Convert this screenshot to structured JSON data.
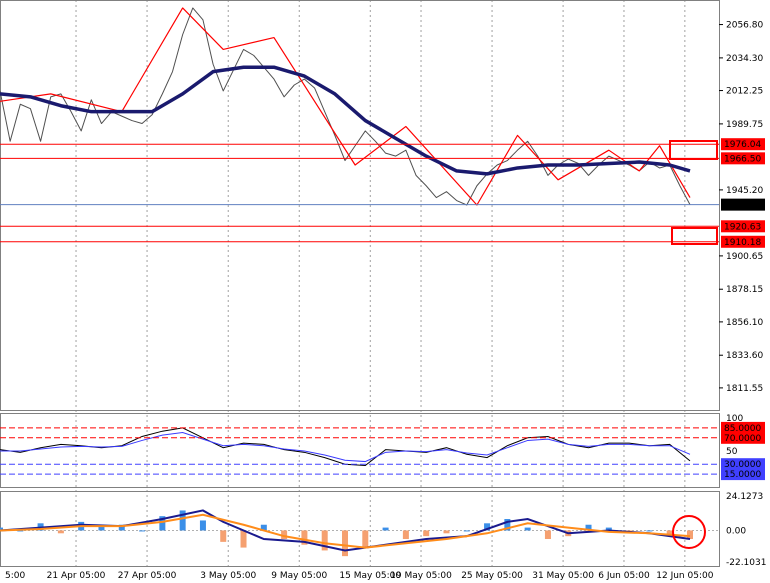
{
  "chart_data": {
    "type": "line",
    "grid": "vertical dotted",
    "title": "",
    "main_panel": {
      "series": [
        {
          "kind": "price",
          "x": [
            0,
            1,
            2,
            3,
            4,
            5,
            6,
            7,
            8,
            9,
            10,
            11,
            12,
            13,
            14,
            15,
            16,
            17,
            18,
            19,
            20,
            21,
            22,
            23,
            24,
            25,
            26,
            27,
            28,
            29,
            30,
            31,
            32,
            33,
            34,
            35,
            36,
            37,
            38,
            39,
            40,
            41,
            42,
            43,
            44,
            45,
            46,
            47,
            48,
            49,
            50,
            51,
            52,
            53,
            54,
            55,
            56,
            57,
            58,
            59,
            60,
            61,
            62,
            63,
            64,
            65,
            66,
            67,
            68
          ],
          "y": [
            2012,
            1978,
            2003,
            2000,
            1978,
            2008,
            2010,
            1998,
            1985,
            2006,
            1990,
            1998,
            1995,
            1992,
            1990,
            1996,
            2010,
            2025,
            2050,
            2068,
            2060,
            2030,
            2012,
            2026,
            2040,
            2036,
            2028,
            2020,
            2008,
            2016,
            2020,
            2014,
            1998,
            1982,
            1965,
            1975,
            1985,
            1978,
            1970,
            1968,
            1972,
            1955,
            1948,
            1940,
            1944,
            1938,
            1935,
            1948,
            1956,
            1962,
            1965,
            1972,
            1978,
            1968,
            1955,
            1962,
            1966,
            1963,
            1955,
            1962,
            1968,
            1965,
            1962,
            1958,
            1964,
            1960,
            1962,
            1948,
            1935.25
          ]
        },
        {
          "kind": "zigzag",
          "x": [
            0,
            5,
            12,
            18,
            22,
            27,
            35,
            40,
            47,
            51,
            55,
            60,
            63,
            65,
            68
          ],
          "y": [
            2005,
            2010,
            1998,
            2068,
            2040,
            2048,
            1962,
            1988,
            1935,
            1982,
            1952,
            1972,
            1958,
            1975,
            1940
          ]
        },
        {
          "kind": "moving_average",
          "x": [
            0,
            3,
            6,
            9,
            12,
            15,
            18,
            21,
            24,
            27,
            30,
            33,
            36,
            39,
            42,
            45,
            48,
            51,
            54,
            57,
            60,
            63,
            66,
            68
          ],
          "y": [
            2010,
            2008,
            2002,
            1998,
            1998,
            1998,
            2010,
            2025,
            2028,
            2028,
            2022,
            2010,
            1992,
            1980,
            1968,
            1958,
            1956,
            1960,
            1962,
            1962,
            1963,
            1964,
            1962,
            1958
          ]
        }
      ],
      "price_axis_ticks": [
        "2056.80",
        "2034.30",
        "2012.25",
        "1989.75",
        "1945.20",
        "1900.65",
        "1878.15",
        "1856.10",
        "1833.60",
        "1811.55"
      ],
      "current_price_label": "1935.25",
      "levels": [
        {
          "label": "1976.04",
          "value": 1976.04,
          "color": "#ff0000"
        },
        {
          "label": "1966.50",
          "value": 1966.5,
          "color": "#ff0000"
        },
        {
          "label": "1920.63",
          "value": 1920.63,
          "color": "#ff0000"
        },
        {
          "label": "1910.18",
          "value": 1910.18,
          "color": "#ff0000"
        }
      ],
      "ylim": [
        1800,
        2070
      ]
    },
    "oscillator_panel": {
      "series": [
        {
          "x": [
            0,
            2,
            4,
            6,
            8,
            10,
            12,
            14,
            16,
            18,
            20,
            22,
            24,
            26,
            28,
            30,
            32,
            34,
            36,
            38,
            40,
            42,
            44,
            46,
            48,
            50,
            52,
            54,
            56,
            58,
            60,
            62,
            64,
            66,
            68
          ],
          "y": [
            52,
            48,
            55,
            60,
            58,
            55,
            58,
            72,
            80,
            85,
            70,
            55,
            62,
            60,
            52,
            48,
            40,
            30,
            28,
            52,
            50,
            48,
            55,
            45,
            40,
            58,
            70,
            72,
            60,
            55,
            62,
            62,
            58,
            60,
            35
          ]
        },
        {
          "x": [
            0,
            2,
            4,
            6,
            8,
            10,
            12,
            14,
            16,
            18,
            20,
            22,
            24,
            26,
            28,
            30,
            32,
            34,
            36,
            38,
            40,
            42,
            44,
            46,
            48,
            50,
            52,
            54,
            56,
            58,
            60,
            62,
            64,
            66,
            68
          ],
          "y": [
            50,
            50,
            53,
            56,
            57,
            56,
            57,
            66,
            74,
            78,
            68,
            58,
            60,
            58,
            53,
            50,
            44,
            36,
            34,
            48,
            50,
            49,
            52,
            47,
            44,
            55,
            66,
            68,
            60,
            57,
            60,
            60,
            58,
            58,
            45
          ]
        }
      ],
      "ticks": [
        "100",
        "50"
      ],
      "levels": [
        {
          "label": "85.0000",
          "value": 85,
          "color": "#ff0000"
        },
        {
          "label": "70.0000",
          "value": 70,
          "color": "#ff0000"
        },
        {
          "label": "30.0000",
          "value": 30,
          "color": "#4040ff"
        },
        {
          "label": "15.0000",
          "value": 15,
          "color": "#4040ff"
        }
      ],
      "ylim": [
        0,
        100
      ]
    },
    "macd_panel": {
      "histogram": {
        "x": [
          0,
          2,
          4,
          6,
          8,
          10,
          12,
          14,
          16,
          18,
          20,
          22,
          24,
          26,
          28,
          30,
          32,
          34,
          36,
          38,
          40,
          42,
          44,
          46,
          48,
          50,
          52,
          54,
          56,
          58,
          60,
          62,
          64,
          66,
          68
        ],
        "y": [
          2,
          0,
          5,
          -2,
          6,
          3,
          4,
          0,
          10,
          14,
          7,
          -8,
          -12,
          4,
          -6,
          -10,
          -14,
          -18,
          -12,
          2,
          -6,
          -4,
          -2,
          0,
          5,
          8,
          2,
          -6,
          -4,
          4,
          2,
          -2,
          0,
          -3,
          -6
        ]
      },
      "macd_line": {
        "x": [
          0,
          4,
          8,
          12,
          16,
          20,
          22,
          26,
          30,
          34,
          38,
          42,
          46,
          50,
          52,
          56,
          60,
          64,
          68
        ],
        "y": [
          0,
          2,
          4,
          3,
          8,
          14,
          6,
          -6,
          -8,
          -14,
          -10,
          -6,
          -4,
          6,
          8,
          -2,
          0,
          -2,
          -6
        ]
      },
      "signal_line": {
        "x": [
          0,
          4,
          8,
          12,
          16,
          20,
          24,
          28,
          32,
          36,
          40,
          44,
          48,
          52,
          56,
          60,
          64,
          68
        ],
        "y": [
          0,
          1,
          3,
          3,
          6,
          11,
          4,
          -4,
          -9,
          -12,
          -9,
          -6,
          -2,
          5,
          2,
          -1,
          -2,
          -4
        ]
      },
      "ticks": [
        "24.1273",
        "0.00",
        "-22.1031"
      ],
      "ylim": [
        -22.1031,
        24.1273
      ]
    },
    "time_axis": {
      "labels": [
        "5:00",
        "21 Apr 05:00",
        "27 Apr 05:00",
        "3 May 05:00",
        "9 May 05:00",
        "15 May 05:00",
        "19 May 05:00",
        "25 May 05:00",
        "31 May 05:00",
        "6 Jun 05:00",
        "12 Jun 05:00"
      ],
      "label_index": [
        0,
        7,
        14,
        22,
        29,
        36,
        41,
        48,
        55,
        61,
        67
      ]
    },
    "annotations": [
      {
        "kind": "rectangle",
        "near_label": "1976.04"
      },
      {
        "kind": "rectangle",
        "near_label": "1920.63"
      },
      {
        "kind": "circle",
        "panel": "macd",
        "position": "last bar"
      }
    ]
  }
}
